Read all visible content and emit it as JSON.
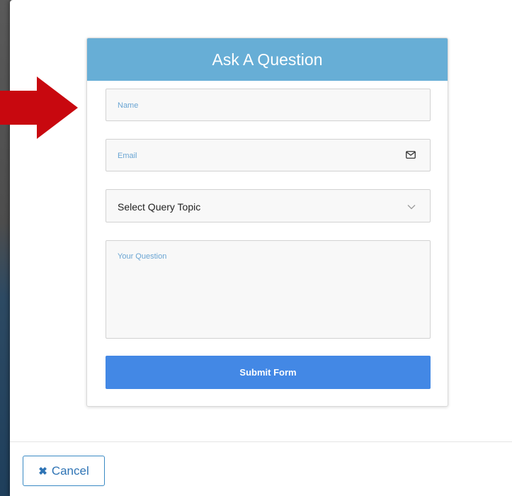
{
  "form": {
    "title": "Ask A Question",
    "name_placeholder": "Name",
    "email_placeholder": "Email",
    "email_icon": "envelope-icon",
    "topic_selected": "Select Query Topic",
    "topic_icon": "chevron-down-icon",
    "question_placeholder": "Your Question",
    "submit_label": "Submit Form"
  },
  "footer": {
    "cancel_label": "Cancel",
    "cancel_icon": "close-icon"
  },
  "annotation": {
    "arrow_icon": "arrow-right-icon",
    "arrow_color": "#c8080f"
  },
  "colors": {
    "header_bg": "#67aed6",
    "submit_bg": "#4388e5",
    "placeholder": "#6aa5d3",
    "cancel_border": "#3a8ac4"
  }
}
